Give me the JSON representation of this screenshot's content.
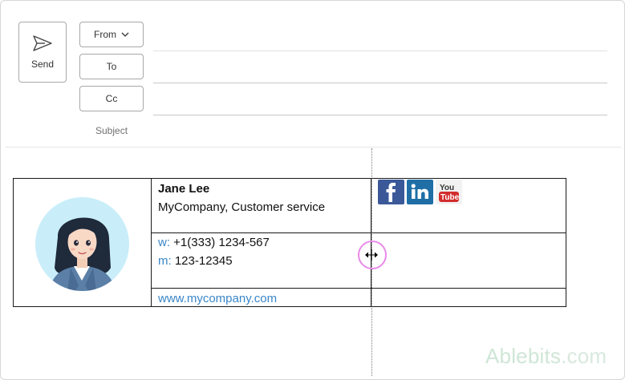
{
  "compose": {
    "send_label": "Send",
    "from_label": "From",
    "to_label": "To",
    "cc_label": "Cc",
    "subject_label": "Subject"
  },
  "signature": {
    "name": "Jane Lee",
    "company": "MyCompany, Customer service",
    "work_phone_prefix": "w:",
    "work_phone": "+1(333) 1234-567",
    "mobile_prefix": "m:",
    "mobile_phone": "123-12345",
    "website": "www.mycompany.com",
    "social_icons": [
      "facebook-icon",
      "linkedin-icon",
      "youtube-icon"
    ]
  },
  "watermark": {
    "brand": "Ablebits",
    "domain": ".com"
  },
  "colors": {
    "link_blue": "#3a86c8",
    "facebook_blue": "#3b5998",
    "linkedin_blue": "#1f6fa6",
    "youtube_red": "#d22d2d",
    "avatar_bg": "#c9eefa",
    "cursor_ring": "#e88ae8"
  }
}
